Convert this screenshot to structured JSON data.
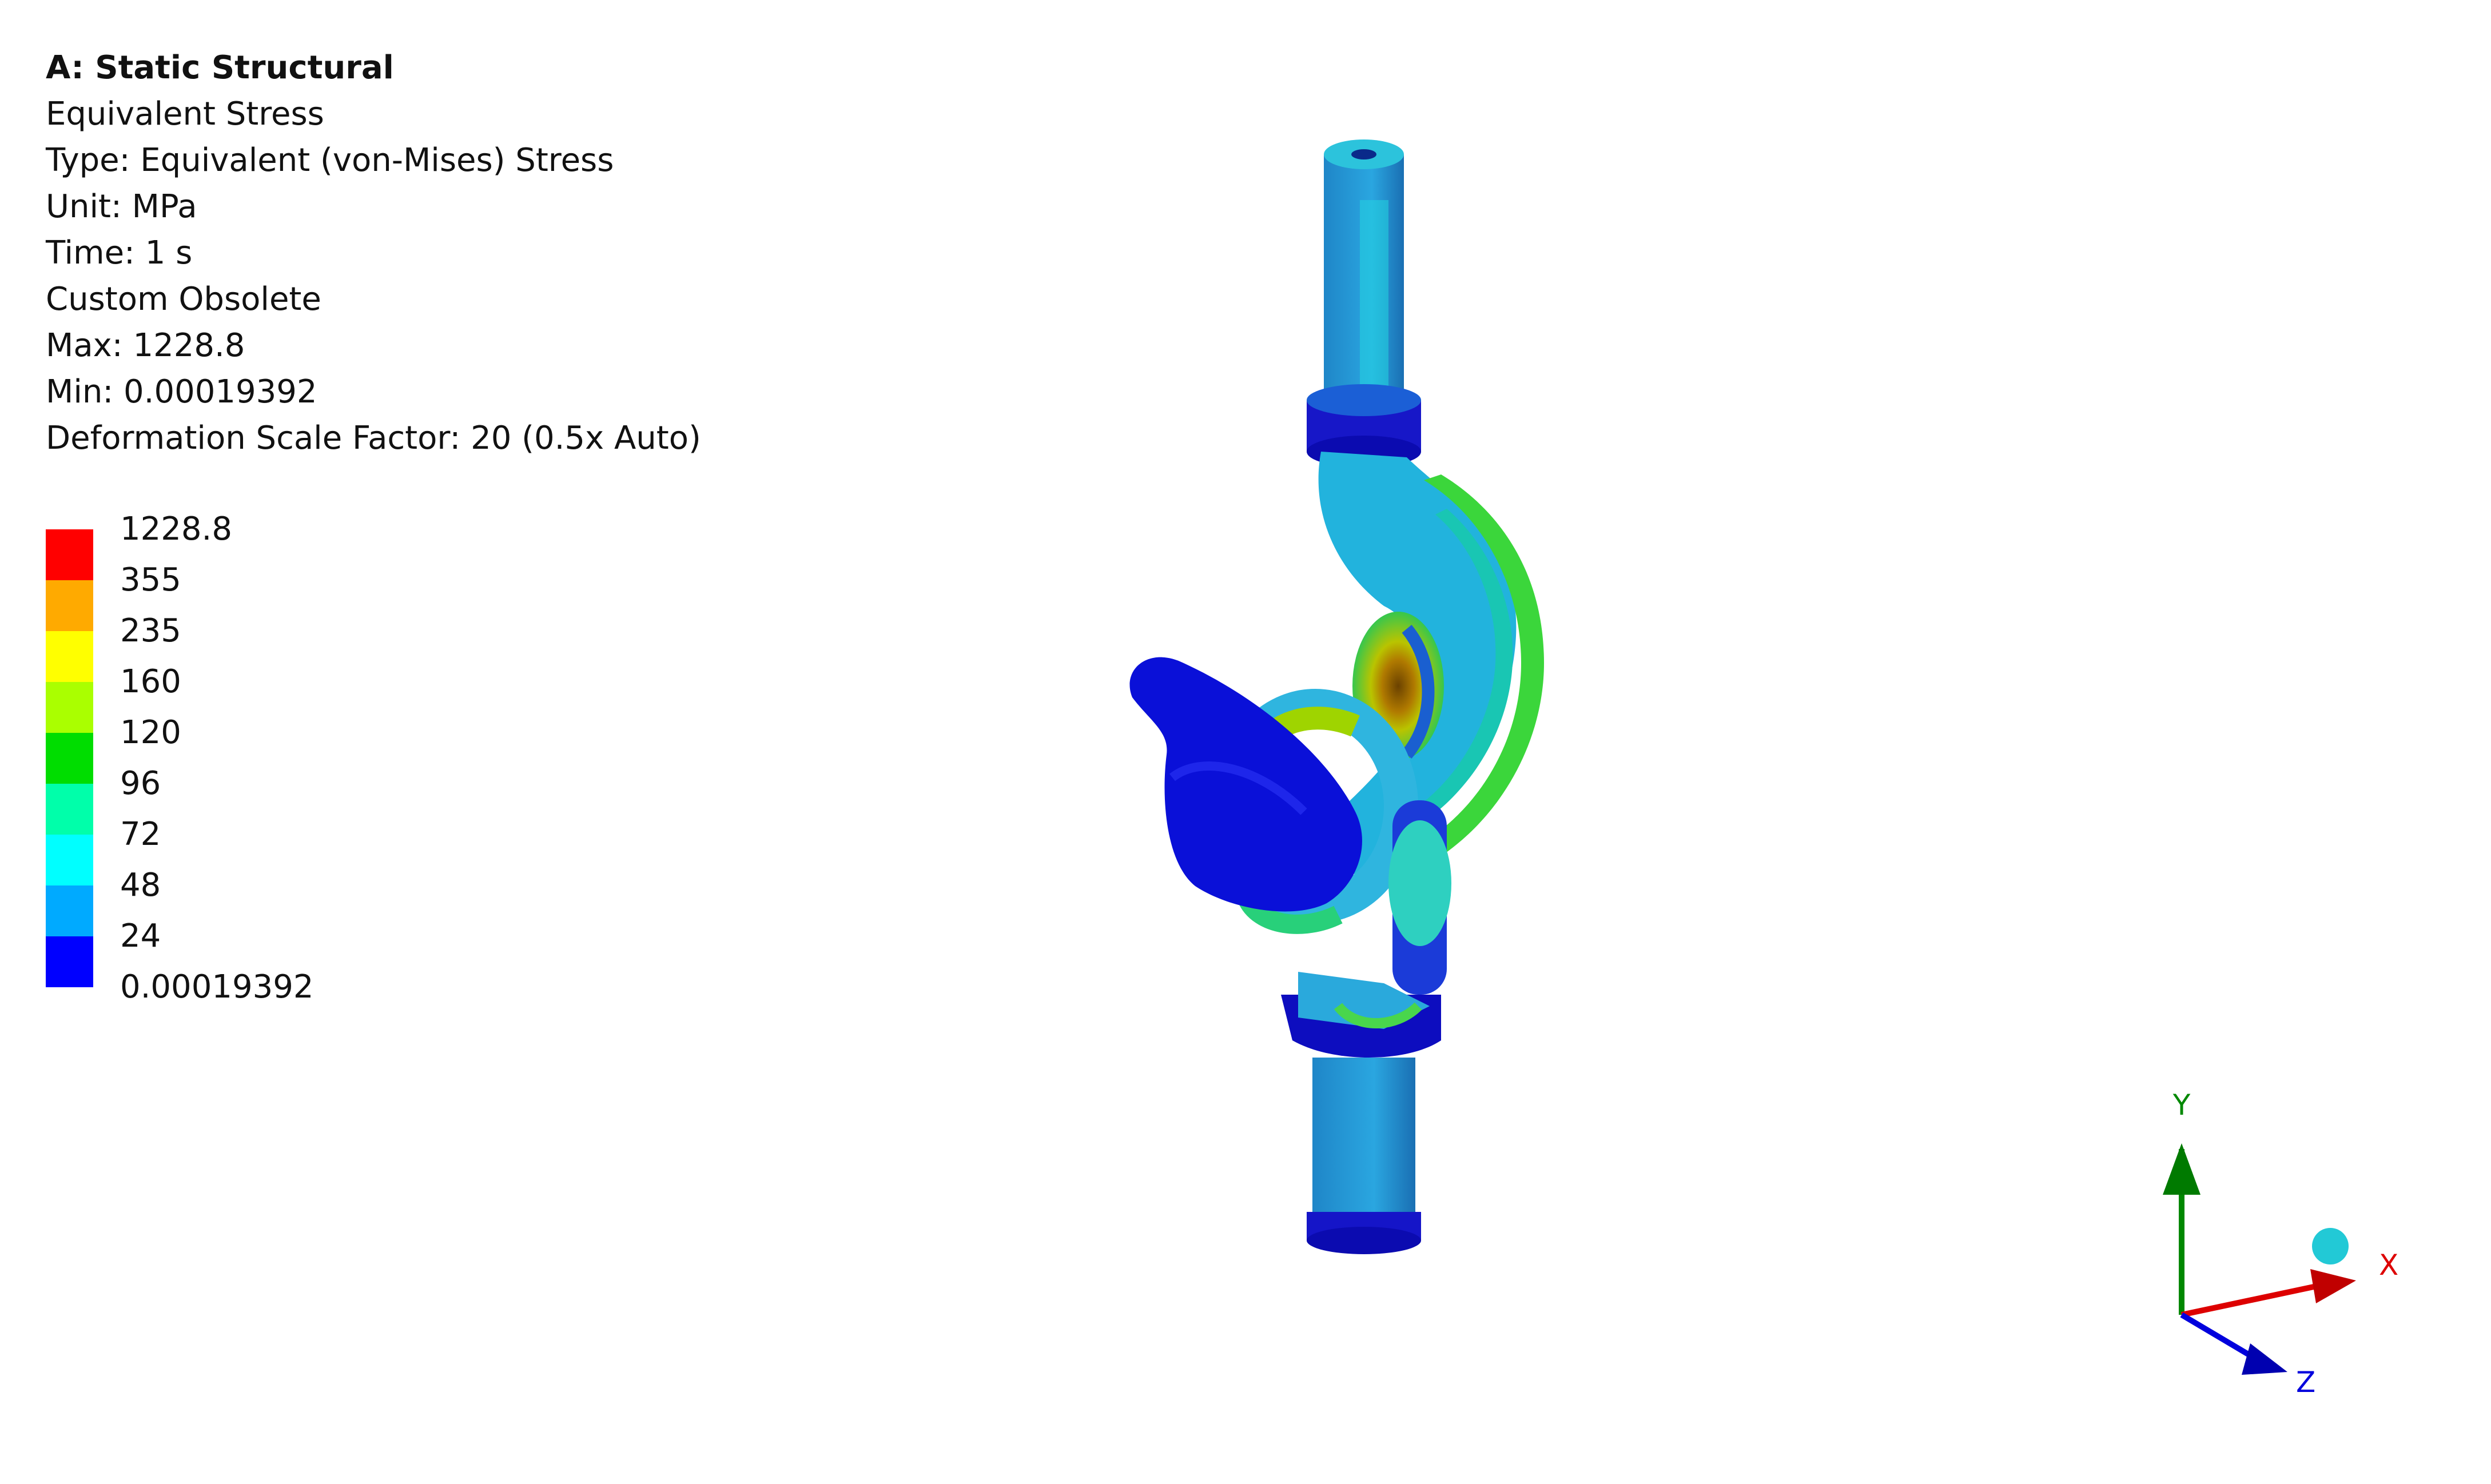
{
  "result_info": {
    "title": "A: Static Structural",
    "result_name": "Equivalent Stress",
    "type": "Type: Equivalent (von-Mises) Stress",
    "unit": "Unit: MPa",
    "time": "Time: 1 s",
    "legend_mode": "Custom Obsolete",
    "max": "Max: 1228.8",
    "min": "Min: 0.00019392",
    "deformation": "Deformation Scale Factor: 20 (0.5x Auto)"
  },
  "legend": {
    "levels": [
      "1228.8",
      "355",
      "235",
      "160",
      "120",
      "96",
      "72",
      "48",
      "24",
      "0.00019392"
    ],
    "colors": [
      "#ff0000",
      "#ffaa00",
      "#ffff00",
      "#aaff00",
      "#00dd00",
      "#00ffaa",
      "#00ffff",
      "#00aaff",
      "#0000ff"
    ]
  },
  "triad": {
    "x_label": "X",
    "y_label": "Y",
    "z_label": "Z",
    "x_color": "#dd0000",
    "y_color": "#008800",
    "z_color": "#0000dd"
  }
}
